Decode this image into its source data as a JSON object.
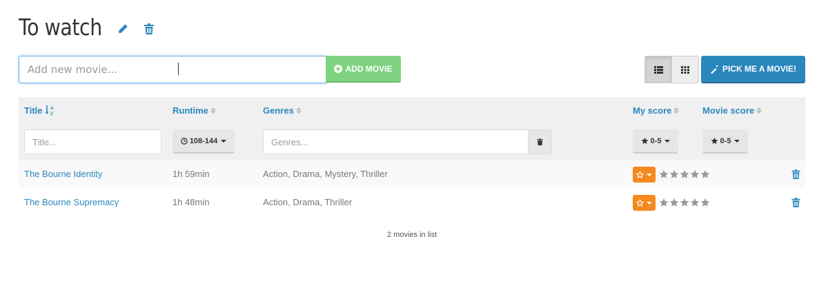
{
  "page": {
    "title": "To watch"
  },
  "add_movie": {
    "placeholder": "Add new movie...",
    "button_label": "ADD MOVIE"
  },
  "toolbar": {
    "pick_label": "PICK ME A MOVIE!"
  },
  "table": {
    "columns": {
      "title": "Title",
      "runtime": "Runtime",
      "genres": "Genres",
      "my_score": "My score",
      "movie_score": "Movie score"
    },
    "filters": {
      "title_placeholder": "Title...",
      "runtime_range": "108-144",
      "genres_placeholder": "Genres...",
      "my_score_range": "0-5",
      "movie_score_range": "0-5"
    },
    "rows": [
      {
        "title": "The Bourne Identity",
        "runtime": "1h 59min",
        "genres": "Action, Drama, Mystery, Thriller",
        "movie_score_stars": 0
      },
      {
        "title": "The Bourne Supremacy",
        "runtime": "1h 48min",
        "genres": "Action, Drama, Thriller",
        "movie_score_stars": 0
      }
    ]
  },
  "footer": {
    "count_text": "2 movies in list"
  },
  "colors": {
    "accent": "#2a87bd",
    "add_green": "#7fd27f",
    "score_orange": "#f5891f",
    "star_gray": "#999999"
  },
  "icons": [
    "pencil-icon",
    "trash-icon",
    "plus-circle-icon",
    "list-view-icon",
    "grid-view-icon",
    "magic-wand-icon",
    "sort-alpha-icon",
    "sort-icon",
    "clock-icon",
    "star-icon",
    "star-outline-icon",
    "caret-down-icon"
  ]
}
